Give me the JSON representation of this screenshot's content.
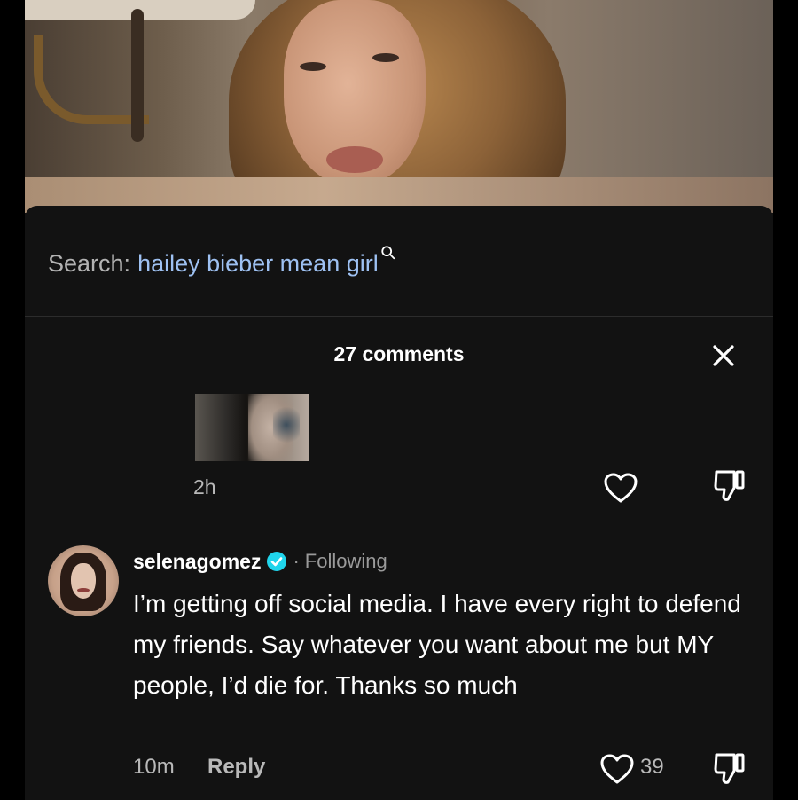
{
  "search": {
    "label": "Search:",
    "query": "hailey bieber mean girl"
  },
  "comments_header": {
    "title": "27 comments"
  },
  "first_comment": {
    "time": "2h"
  },
  "main_comment": {
    "username": "selenagomez",
    "verified": true,
    "separator": "·",
    "relation": "Following",
    "text": "I’m getting off social media. I have every right to defend my friends. Say whatever you want about me but MY people, I’d die for. Thanks so much",
    "time": "10m",
    "reply_label": "Reply",
    "like_count": "39"
  },
  "colors": {
    "panel_bg": "#121212",
    "search_query": "#9ec1f2",
    "verified": "#20d5ec",
    "muted_text": "#b9b9b9"
  },
  "icons": {
    "search": "search-icon",
    "close": "close-icon",
    "like": "heart-outline-icon",
    "dislike": "thumbs-down-icon",
    "verified": "verified-badge-icon"
  }
}
